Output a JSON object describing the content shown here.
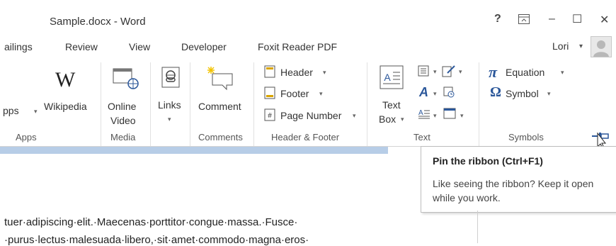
{
  "window": {
    "title": "Sample.docx - Word",
    "help_label": "?",
    "ribbon_display_icon": "ribbon-display-options-icon",
    "minimize_label": "–",
    "maximize_label": "☐",
    "close_label": "✕"
  },
  "tabs": [
    {
      "label": "ailings"
    },
    {
      "label": "Review"
    },
    {
      "label": "View"
    },
    {
      "label": "Developer"
    },
    {
      "label": "Foxit Reader PDF"
    }
  ],
  "user": {
    "name": "Lori",
    "caret": "▾"
  },
  "ribbon": {
    "apps": {
      "apps_label_partial": "pps",
      "apps_caret": "▾",
      "wikipedia_glyph": "W",
      "wikipedia_label": "Wikipedia",
      "group_label": "Apps"
    },
    "media": {
      "online_video_label_1": "Online",
      "online_video_label_2": "Video",
      "group_label": "Media"
    },
    "links": {
      "label": "Links",
      "caret": "▾"
    },
    "comments": {
      "comment_label": "Comment",
      "group_label": "Comments"
    },
    "header_footer": {
      "header_label": "Header",
      "footer_label": "Footer",
      "page_number_label": "Page Number",
      "caret": "▾",
      "group_label": "Header & Footer"
    },
    "text": {
      "text_box_label_1": "Text",
      "text_box_label_2": "Box",
      "caret": "▾",
      "group_label": "Text"
    },
    "symbols": {
      "pi_glyph": "π",
      "equation_label": "Equation",
      "omega_glyph": "Ω",
      "symbol_label": "Symbol",
      "caret": "▾",
      "group_label": "Symbols"
    }
  },
  "tooltip": {
    "title": "Pin the ribbon (Ctrl+F1)",
    "description": "Like seeing the ribbon? Keep it open while you work."
  },
  "document": {
    "line1": "tuer·adipiscing·elit.·Maecenas·porttitor·congue·massa.·Fusce·",
    "line2": "·purus·lectus·malesuada·libero,·sit·amet·commodo·magna·eros·"
  },
  "colors": {
    "accent_blue": "#2b579a",
    "strip_blue": "#b7cde7"
  }
}
